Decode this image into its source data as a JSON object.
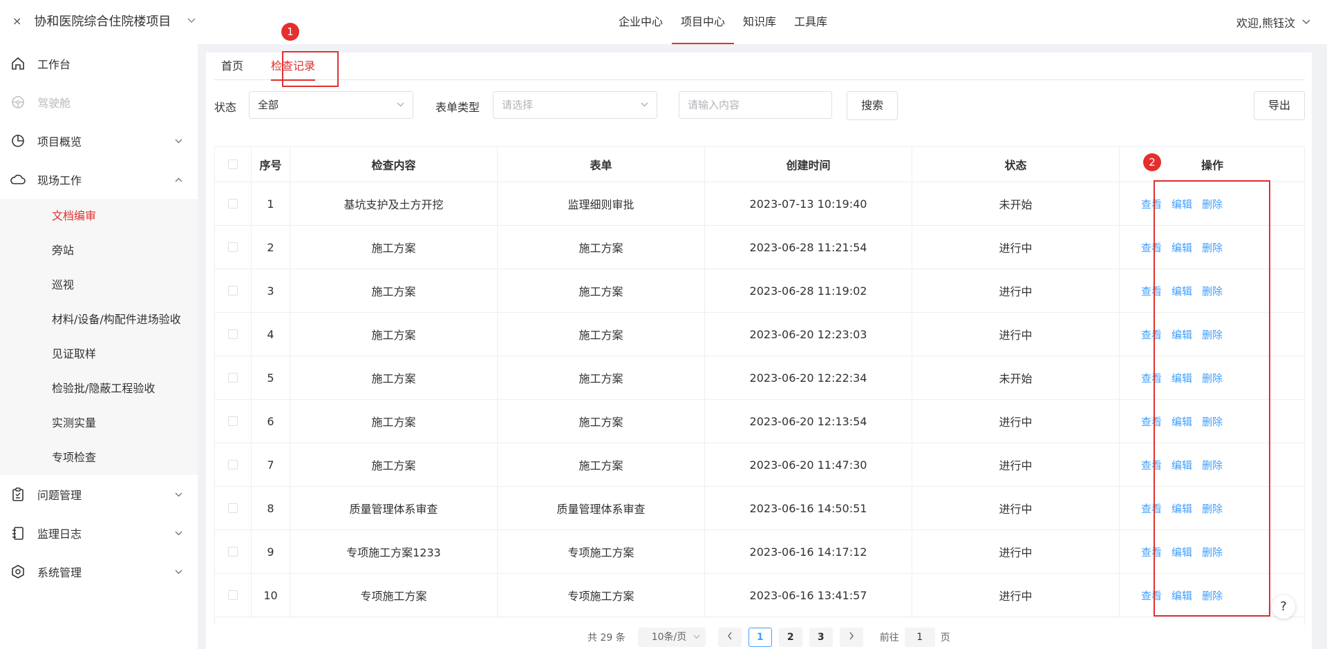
{
  "header": {
    "close_glyph": "×",
    "project_title": "协和医院综合住院楼项目",
    "nav": [
      "企业中心",
      "项目中心",
      "知识库",
      "工具库"
    ],
    "user": "欢迎,熊钰汶"
  },
  "sidebar": {
    "items": [
      {
        "label": "工作台",
        "icon": "home-icon"
      },
      {
        "label": "驾驶舱",
        "icon": "steering-wheel-icon",
        "disabled": true
      },
      {
        "label": "项目概览",
        "icon": "pie-chart-icon",
        "expandable": true
      },
      {
        "label": "现场工作",
        "icon": "cloud-icon",
        "expandable": true,
        "expanded": true
      }
    ],
    "subitems": [
      "文档编审",
      "旁站",
      "巡视",
      "材料/设备/构配件进场验收",
      "见证取样",
      "检验批/隐蔽工程验收",
      "实测实量",
      "专项检查"
    ],
    "active_subitem": "文档编审",
    "bottom_items": [
      {
        "label": "问题管理",
        "icon": "clipboard-icon"
      },
      {
        "label": "监理日志",
        "icon": "notebook-icon"
      },
      {
        "label": "系统管理",
        "icon": "settings-hex-icon"
      }
    ]
  },
  "tabs": [
    "首页",
    "检查记录"
  ],
  "active_tab": "检查记录",
  "annotations": [
    "1",
    "2"
  ],
  "filters": {
    "status_label": "状态",
    "status_value": "全部",
    "form_type_label": "表单类型",
    "form_type_placeholder": "请选择",
    "keyword_placeholder": "请输入内容",
    "search_button": "搜索",
    "export_button": "导出"
  },
  "table": {
    "columns": [
      "序号",
      "检查内容",
      "表单",
      "创建时间",
      "状态",
      "操作"
    ],
    "actions": [
      "查看",
      "编辑",
      "删除"
    ],
    "rows": [
      {
        "idx": "1",
        "content": "基坑支护及土方开挖",
        "form": "监理细则审批",
        "time": "2023-07-13 10:19:40",
        "status": "未开始"
      },
      {
        "idx": "2",
        "content": "施工方案",
        "form": "施工方案",
        "time": "2023-06-28 11:21:54",
        "status": "进行中"
      },
      {
        "idx": "3",
        "content": "施工方案",
        "form": "施工方案",
        "time": "2023-06-28 11:19:02",
        "status": "进行中"
      },
      {
        "idx": "4",
        "content": "施工方案",
        "form": "施工方案",
        "time": "2023-06-20 12:23:03",
        "status": "进行中"
      },
      {
        "idx": "5",
        "content": "施工方案",
        "form": "施工方案",
        "time": "2023-06-20 12:22:34",
        "status": "未开始"
      },
      {
        "idx": "6",
        "content": "施工方案",
        "form": "施工方案",
        "time": "2023-06-20 12:13:54",
        "status": "进行中"
      },
      {
        "idx": "7",
        "content": "施工方案",
        "form": "施工方案",
        "time": "2023-06-20 11:47:30",
        "status": "进行中"
      },
      {
        "idx": "8",
        "content": "质量管理体系审查",
        "form": "质量管理体系审查",
        "time": "2023-06-16 14:50:51",
        "status": "进行中"
      },
      {
        "idx": "9",
        "content": "专项施工方案1233",
        "form": "专项施工方案",
        "time": "2023-06-16 14:17:12",
        "status": "进行中"
      },
      {
        "idx": "10",
        "content": "专项施工方案",
        "form": "专项施工方案",
        "time": "2023-06-16 13:41:57",
        "status": "进行中"
      }
    ]
  },
  "pagination": {
    "total": "共 29 条",
    "page_size": "10条/页",
    "pages": [
      "1",
      "2",
      "3"
    ],
    "current": "1",
    "goto_prefix": "前往",
    "goto_value": "1",
    "goto_suffix": "页"
  },
  "help_glyph": "?",
  "colors": {
    "accent": "#e02f2f",
    "link": "#409eff"
  }
}
